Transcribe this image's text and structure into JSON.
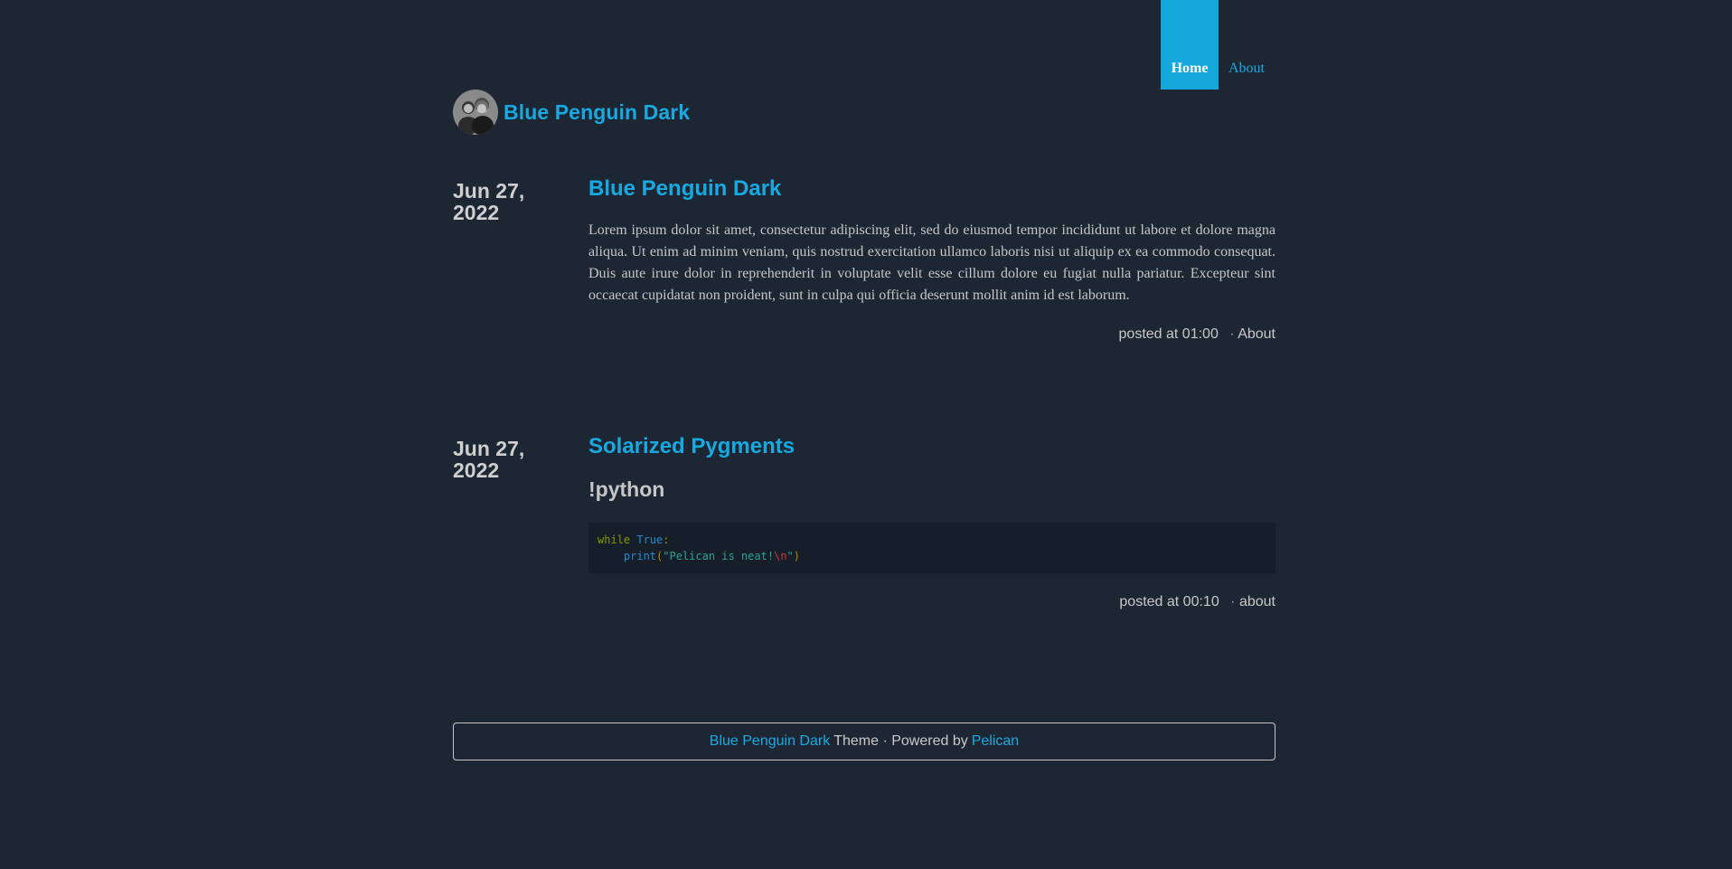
{
  "nav": {
    "items": [
      {
        "label": "Home",
        "active": true
      },
      {
        "label": "About",
        "active": false
      }
    ]
  },
  "header": {
    "avatar_icon": "avatar-photo",
    "title": "Blue Penguin Dark"
  },
  "posts": [
    {
      "date_line1": "Jun 27,",
      "date_line2": "2022",
      "title": "Blue Penguin Dark",
      "text": "Lorem ipsum dolor sit amet, consectetur adipiscing elit, sed do eiusmod tempor incididunt ut labore et dolore magna aliqua. Ut enim ad minim veniam, quis nostrud exercitation ullamco laboris nisi ut aliquip ex ea commodo consequat. Duis aute irure dolor in reprehenderit in voluptate velit esse cillum dolore eu fugiat nulla pariatur. Excepteur sint occaecat cupidatat non proident, sunt in culpa qui officia deserunt mollit anim id est laborum.",
      "meta_posted": "posted at 01:00",
      "meta_sep": "·",
      "meta_category": "About"
    },
    {
      "date_line1": "Jun 27,",
      "date_line2": "2022",
      "title": "Solarized Pygments",
      "subhead": "!python",
      "code": {
        "line1_kw": "while",
        "line1_builtin": "True",
        "line1_colon": ":",
        "line2_indent": "    ",
        "line2_fn": "print",
        "line2_open": "(",
        "line2_str": "\"Pelican is neat!",
        "line2_esc": "\\n",
        "line2_str_end": "\"",
        "line2_close": ")"
      },
      "meta_posted": "posted at 00:10",
      "meta_sep": "·",
      "meta_category": "about"
    }
  ],
  "footer": {
    "theme_link": "Blue Penguin Dark",
    "theme_text": "Theme · Powered by",
    "pelican_link": "Pelican"
  },
  "colors": {
    "background": "#1d2734",
    "accent": "#19a9e1",
    "nav_active_bg": "#15a8dd",
    "code_bg": "#161e29",
    "text": "#c9c9c9"
  }
}
